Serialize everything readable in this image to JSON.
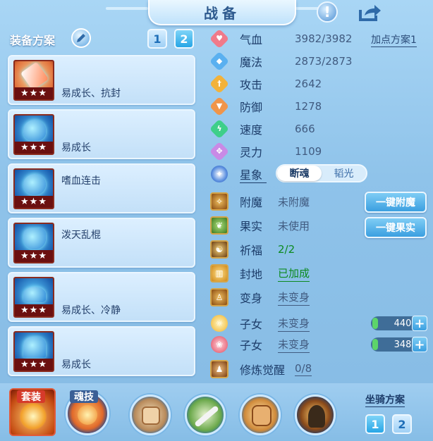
{
  "header": {
    "title": "战备"
  },
  "left": {
    "title": "装备方案",
    "schemes": [
      "1",
      "2"
    ],
    "equipment": [
      {
        "note": "易成长、抗封",
        "stars": "★★★"
      },
      {
        "note": "易成长",
        "stars": "★★★"
      },
      {
        "note": "嗜血连击",
        "stars": "★★★"
      },
      {
        "note": "泼天乱棍",
        "stars": "★★★"
      },
      {
        "note": "易成长、冷静",
        "stars": "★★★"
      },
      {
        "note": "易成长",
        "stars": "★★★"
      }
    ]
  },
  "stats": {
    "add_plan": "加点方案1",
    "hp": {
      "label": "气血",
      "value": "3982/3982"
    },
    "mp": {
      "label": "魔法",
      "value": "2873/2873"
    },
    "atk": {
      "label": "攻击",
      "value": "2642"
    },
    "def": {
      "label": "防御",
      "value": "1278"
    },
    "spd": {
      "label": "速度",
      "value": "666"
    },
    "spi": {
      "label": "灵力",
      "value": "1109"
    },
    "constellation": {
      "label": "星象",
      "options": [
        "断魂",
        "韬光"
      ],
      "selected": "断魂"
    }
  },
  "extras": {
    "enchant": {
      "label": "附魔",
      "value": "未附魔",
      "button": "一键附魔"
    },
    "fruit": {
      "label": "果实",
      "value": "未使用",
      "button": "一键果实"
    },
    "blessing": {
      "label": "祈福",
      "value": "2/2"
    },
    "fengdi": {
      "label": "封地",
      "value": "已加成"
    },
    "transform": {
      "label": "变身",
      "value": "未变身"
    },
    "child1": {
      "label": "子女",
      "value": "未变身",
      "points": "440"
    },
    "child2": {
      "label": "子女",
      "value": "未变身",
      "points": "348"
    },
    "cultivation": {
      "label": "修炼觉醒",
      "value": "0/8"
    }
  },
  "bottom": {
    "suit_label": "套装",
    "soul_label": "魂技",
    "mount_title": "坐骑方案",
    "mount_schemes": [
      "1",
      "2"
    ]
  },
  "colors": {
    "accent": "#3b9fe0",
    "green_value": "#0c8a20",
    "frame_red": "#8a2b1e"
  }
}
